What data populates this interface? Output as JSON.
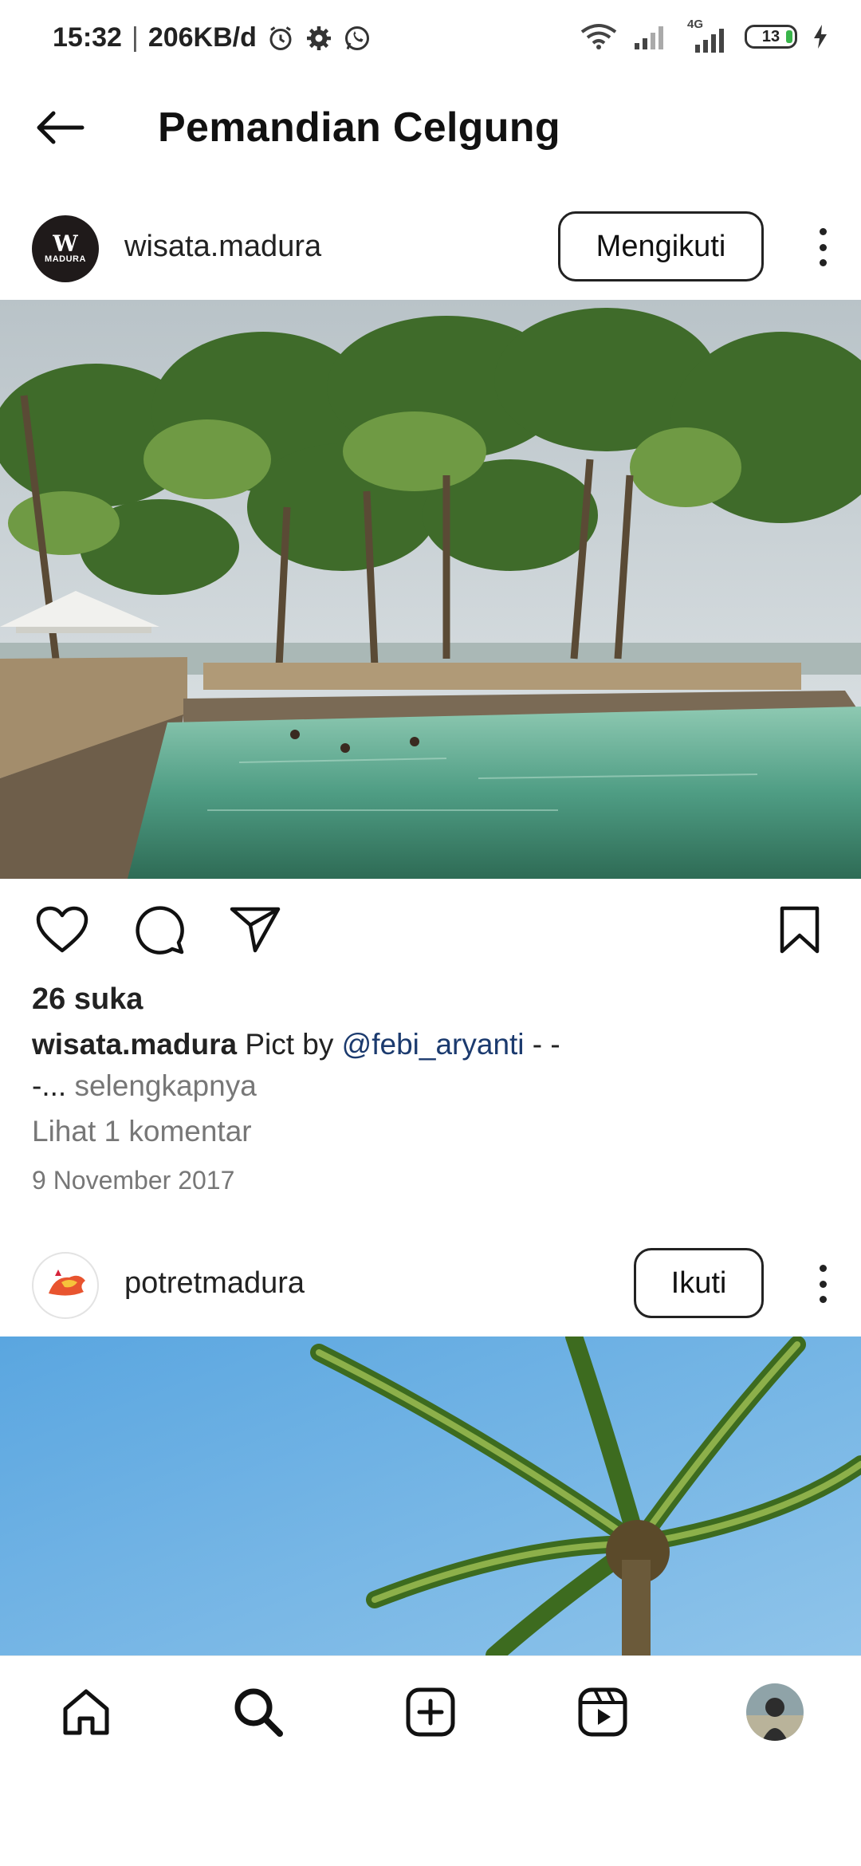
{
  "status_bar": {
    "time": "15:32",
    "speed": "206KB/d",
    "network_label": "4G",
    "battery": "13"
  },
  "header": {
    "title": "Pemandian Celgung"
  },
  "post1": {
    "username": "wisata.madura",
    "avatar_text": "MADURA",
    "follow_label": "Mengikuti",
    "likes": "26 suka",
    "caption_user": "wisata.madura",
    "caption_text": " Pict by ",
    "caption_mention": "@febi_aryanti",
    "caption_tail": " - -",
    "caption_line2": "-...",
    "caption_more": " selengkapnya",
    "comments_link": "Lihat 1 komentar",
    "date": "9 November 2017"
  },
  "post2": {
    "username": "potretmadura",
    "follow_label": "Ikuti"
  },
  "icons": {
    "back": "arrow-left-icon",
    "like": "heart-icon",
    "comment": "comment-bubble-icon",
    "share": "paper-plane-icon",
    "save": "bookmark-icon",
    "more": "kebab-menu-icon",
    "nav_home": "home-icon",
    "nav_search": "search-icon",
    "nav_create": "plus-square-icon",
    "nav_reels": "reels-icon"
  },
  "colors": {
    "mention": "#1b3a6e",
    "muted": "#777777",
    "text": "#222222"
  }
}
